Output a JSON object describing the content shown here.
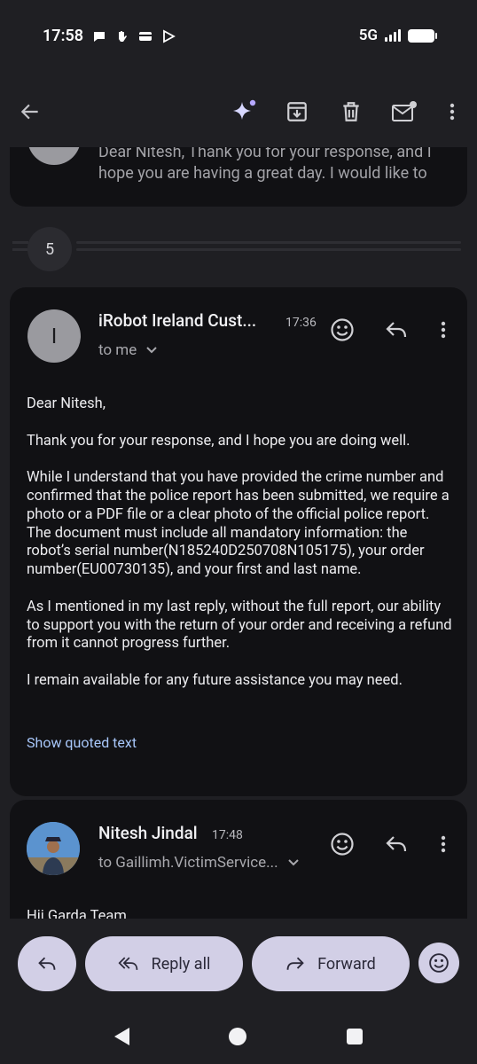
{
  "status_bar": {
    "time": "17:58",
    "network": "5G"
  },
  "toolbar": {
    "back_icon": "arrow-left-icon",
    "sparkle_icon": "gemini-sparkle-icon",
    "archive_icon": "archive-icon",
    "delete_icon": "trash-icon",
    "unread_icon": "mark-unread-icon",
    "more_icon": "more-vert-icon"
  },
  "previous_message": {
    "snippet": "Dear Nitesh, Thank you for your response, and I hope you are having a great day. I would like to"
  },
  "collapsed_count": "5",
  "message": {
    "avatar_letter": "I",
    "sender": "iRobot Ireland Cust...",
    "time": "17:36",
    "to": "to me",
    "body": [
      "Dear Nitesh,",
      "Thank you for your response, and I hope you are doing well.",
      "While I understand that you have provided the crime number and confirmed that the police report has been submitted, we require a photo or a PDF file or a clear photo of the official police report. The document must include all mandatory information: the robot’s serial number(N185240D250708N105175), your order number(EU00730135), and your first and last name.",
      "As I mentioned in my last reply, without the full report, our ability to support you with the return of your order and receiving a refund from it cannot progress further.",
      "I remain available for any future assistance you may need."
    ],
    "show_quoted": "Show quoted text"
  },
  "next_message": {
    "sender": "Nitesh Jindal",
    "time": "17:48",
    "to": "to Gaillimh.VictimService...",
    "snippet": "Hii Garda Team"
  },
  "actions": {
    "reply_all": "Reply all",
    "forward": "Forward"
  },
  "colors": {
    "background": "#1f1f23",
    "card": "#111114",
    "pill": "#d2cfe6",
    "link": "#a8c7fa"
  }
}
